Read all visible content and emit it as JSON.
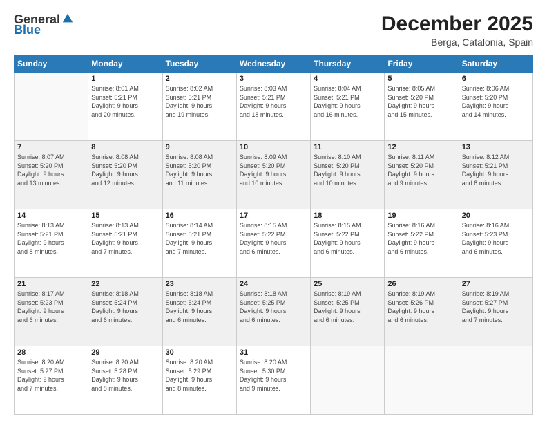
{
  "header": {
    "logo": {
      "text_general": "General",
      "text_blue": "Blue"
    },
    "title": "December 2025",
    "subtitle": "Berga, Catalonia, Spain"
  },
  "calendar": {
    "days_of_week": [
      "Sunday",
      "Monday",
      "Tuesday",
      "Wednesday",
      "Thursday",
      "Friday",
      "Saturday"
    ],
    "weeks": [
      [
        {
          "day": "",
          "info": ""
        },
        {
          "day": "1",
          "info": "Sunrise: 8:01 AM\nSunset: 5:21 PM\nDaylight: 9 hours\nand 20 minutes."
        },
        {
          "day": "2",
          "info": "Sunrise: 8:02 AM\nSunset: 5:21 PM\nDaylight: 9 hours\nand 19 minutes."
        },
        {
          "day": "3",
          "info": "Sunrise: 8:03 AM\nSunset: 5:21 PM\nDaylight: 9 hours\nand 18 minutes."
        },
        {
          "day": "4",
          "info": "Sunrise: 8:04 AM\nSunset: 5:21 PM\nDaylight: 9 hours\nand 16 minutes."
        },
        {
          "day": "5",
          "info": "Sunrise: 8:05 AM\nSunset: 5:20 PM\nDaylight: 9 hours\nand 15 minutes."
        },
        {
          "day": "6",
          "info": "Sunrise: 8:06 AM\nSunset: 5:20 PM\nDaylight: 9 hours\nand 14 minutes."
        }
      ],
      [
        {
          "day": "7",
          "info": "Sunrise: 8:07 AM\nSunset: 5:20 PM\nDaylight: 9 hours\nand 13 minutes."
        },
        {
          "day": "8",
          "info": "Sunrise: 8:08 AM\nSunset: 5:20 PM\nDaylight: 9 hours\nand 12 minutes."
        },
        {
          "day": "9",
          "info": "Sunrise: 8:08 AM\nSunset: 5:20 PM\nDaylight: 9 hours\nand 11 minutes."
        },
        {
          "day": "10",
          "info": "Sunrise: 8:09 AM\nSunset: 5:20 PM\nDaylight: 9 hours\nand 10 minutes."
        },
        {
          "day": "11",
          "info": "Sunrise: 8:10 AM\nSunset: 5:20 PM\nDaylight: 9 hours\nand 10 minutes."
        },
        {
          "day": "12",
          "info": "Sunrise: 8:11 AM\nSunset: 5:20 PM\nDaylight: 9 hours\nand 9 minutes."
        },
        {
          "day": "13",
          "info": "Sunrise: 8:12 AM\nSunset: 5:21 PM\nDaylight: 9 hours\nand 8 minutes."
        }
      ],
      [
        {
          "day": "14",
          "info": "Sunrise: 8:13 AM\nSunset: 5:21 PM\nDaylight: 9 hours\nand 8 minutes."
        },
        {
          "day": "15",
          "info": "Sunrise: 8:13 AM\nSunset: 5:21 PM\nDaylight: 9 hours\nand 7 minutes."
        },
        {
          "day": "16",
          "info": "Sunrise: 8:14 AM\nSunset: 5:21 PM\nDaylight: 9 hours\nand 7 minutes."
        },
        {
          "day": "17",
          "info": "Sunrise: 8:15 AM\nSunset: 5:22 PM\nDaylight: 9 hours\nand 6 minutes."
        },
        {
          "day": "18",
          "info": "Sunrise: 8:15 AM\nSunset: 5:22 PM\nDaylight: 9 hours\nand 6 minutes."
        },
        {
          "day": "19",
          "info": "Sunrise: 8:16 AM\nSunset: 5:22 PM\nDaylight: 9 hours\nand 6 minutes."
        },
        {
          "day": "20",
          "info": "Sunrise: 8:16 AM\nSunset: 5:23 PM\nDaylight: 9 hours\nand 6 minutes."
        }
      ],
      [
        {
          "day": "21",
          "info": "Sunrise: 8:17 AM\nSunset: 5:23 PM\nDaylight: 9 hours\nand 6 minutes."
        },
        {
          "day": "22",
          "info": "Sunrise: 8:18 AM\nSunset: 5:24 PM\nDaylight: 9 hours\nand 6 minutes."
        },
        {
          "day": "23",
          "info": "Sunrise: 8:18 AM\nSunset: 5:24 PM\nDaylight: 9 hours\nand 6 minutes."
        },
        {
          "day": "24",
          "info": "Sunrise: 8:18 AM\nSunset: 5:25 PM\nDaylight: 9 hours\nand 6 minutes."
        },
        {
          "day": "25",
          "info": "Sunrise: 8:19 AM\nSunset: 5:25 PM\nDaylight: 9 hours\nand 6 minutes."
        },
        {
          "day": "26",
          "info": "Sunrise: 8:19 AM\nSunset: 5:26 PM\nDaylight: 9 hours\nand 6 minutes."
        },
        {
          "day": "27",
          "info": "Sunrise: 8:19 AM\nSunset: 5:27 PM\nDaylight: 9 hours\nand 7 minutes."
        }
      ],
      [
        {
          "day": "28",
          "info": "Sunrise: 8:20 AM\nSunset: 5:27 PM\nDaylight: 9 hours\nand 7 minutes."
        },
        {
          "day": "29",
          "info": "Sunrise: 8:20 AM\nSunset: 5:28 PM\nDaylight: 9 hours\nand 8 minutes."
        },
        {
          "day": "30",
          "info": "Sunrise: 8:20 AM\nSunset: 5:29 PM\nDaylight: 9 hours\nand 8 minutes."
        },
        {
          "day": "31",
          "info": "Sunrise: 8:20 AM\nSunset: 5:30 PM\nDaylight: 9 hours\nand 9 minutes."
        },
        {
          "day": "",
          "info": ""
        },
        {
          "day": "",
          "info": ""
        },
        {
          "day": "",
          "info": ""
        }
      ]
    ]
  }
}
